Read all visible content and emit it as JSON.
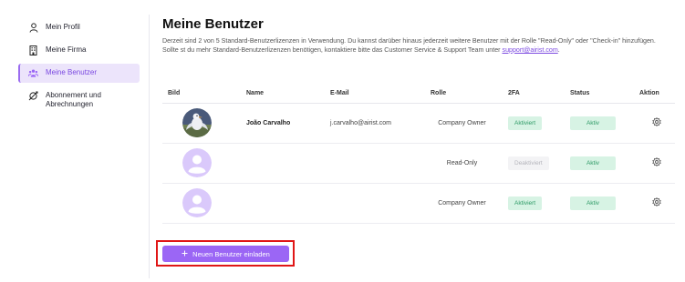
{
  "sidebar": {
    "items": [
      {
        "label": "Mein Profil",
        "icon": "user-icon"
      },
      {
        "label": "Meine Firma",
        "icon": "building-icon"
      },
      {
        "label": "Meine Benutzer",
        "icon": "users-icon",
        "active": true
      },
      {
        "label": "Abonnement und Abrechnungen",
        "icon": "subscription-icon"
      }
    ]
  },
  "main": {
    "title": "Meine Benutzer",
    "description": "Derzeit sind 2 von 5 Standard-Benutzerlizenzen in Verwendung. Du kannst darüber hinaus jederzeit weitere Benutzer mit der Rolle \"Read-Only\" oder \"Check-in\" hinzufügen. Sollte st du mehr Standard-Benutzerlizenzen benötigen, kontaktiere bitte das Customer Service & Support Team unter",
    "support_email": "support@airist.com",
    "description_end": "."
  },
  "table": {
    "headers": {
      "bild": "Bild",
      "name": "Name",
      "email": "E-Mail",
      "rolle": "Rolle",
      "twofa": "2FA",
      "status": "Status",
      "aktion": "Aktion"
    },
    "rows": [
      {
        "name": "João Carvalho",
        "email": "j.carvalho@airist.com",
        "rolle": "Company Owner",
        "twofa": "Aktiviert",
        "twofa_on": true,
        "status": "Aktiv",
        "avatar": "photo"
      },
      {
        "name": "",
        "email": "",
        "rolle": "Read-Only",
        "twofa": "Deaktiviert",
        "twofa_on": false,
        "status": "Aktiv",
        "avatar": "placeholder"
      },
      {
        "name": "",
        "email": "",
        "rolle": "Company Owner",
        "twofa": "Aktiviert",
        "twofa_on": true,
        "status": "Aktiv",
        "avatar": "placeholder"
      }
    ]
  },
  "invite": {
    "label": "Neuen Benutzer einladen",
    "icon": "plus-icon"
  },
  "colors": {
    "accent": "#9b66f5",
    "active_bg": "#ece4fb",
    "badge_green_bg": "#d7f3e4",
    "badge_green_text": "#2e9a66",
    "highlight": "#e01616"
  }
}
